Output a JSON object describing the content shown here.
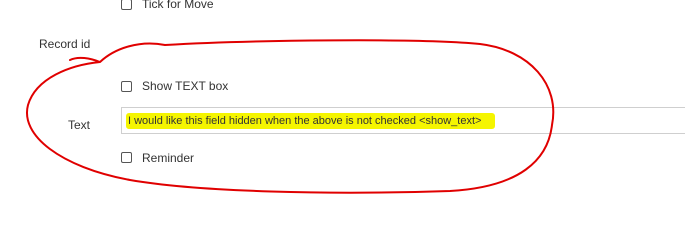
{
  "form": {
    "tick_for_move": {
      "label": "Tick for Move",
      "checked": false
    },
    "record_id": {
      "label": "Record id",
      "value": ""
    },
    "show_text_box": {
      "label": "Show TEXT box",
      "checked": false
    },
    "text_field": {
      "label": "Text",
      "value": "I would like this field hidden when the above is not checked <show_text>"
    },
    "reminder": {
      "label": "Reminder",
      "checked": false
    }
  },
  "annotation": {
    "highlight_color": "#f5f500",
    "circle_color": "#e00000"
  }
}
